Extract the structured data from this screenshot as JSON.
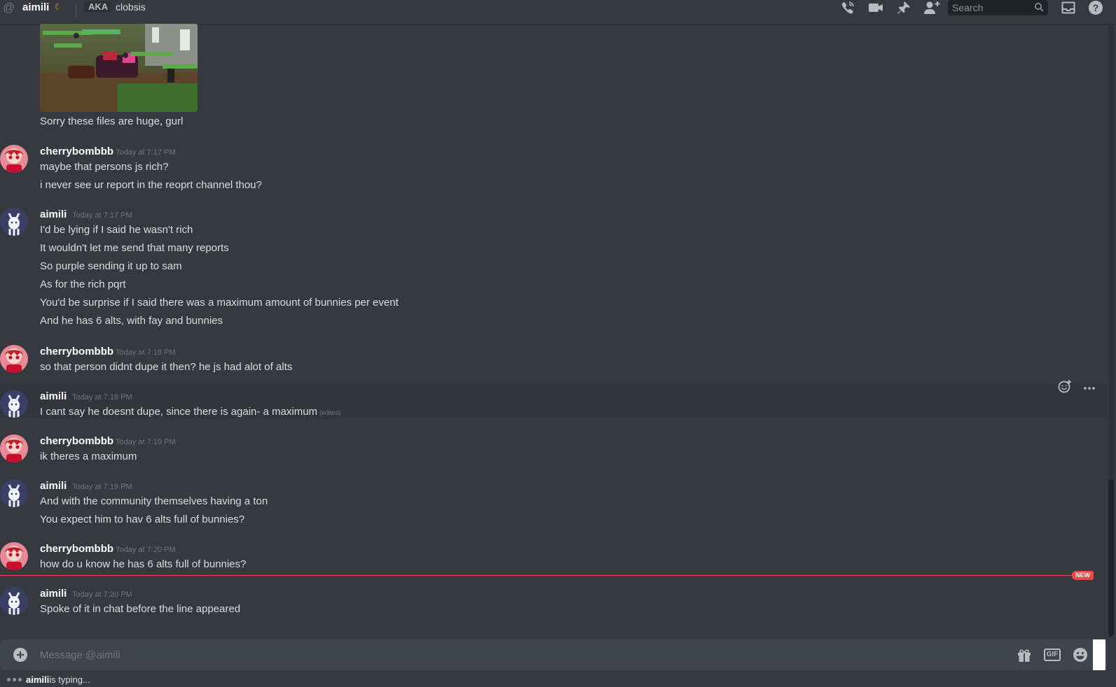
{
  "header": {
    "username": "aimili",
    "aka_label": "AKA",
    "nickname": "clobsis",
    "search_placeholder": "Search"
  },
  "attachment": {
    "caption": "Sorry these files are huge, gurl"
  },
  "messages": [
    {
      "author": "cherrybombbb",
      "timestamp": "Today at 7:17 PM",
      "lines": [
        "maybe that persons js rich?",
        "i never see ur report in the reoprt channel thou?"
      ]
    },
    {
      "author": "aimili",
      "timestamp": "Today at 7:17 PM",
      "lines": [
        "I'd be lying if I said he wasn't rich",
        "It wouldn't let me send that many reports",
        "So purple sending it up to sam",
        "As for the rich pqrt",
        "You'd be surprise if I said there was a maximum amount of bunnies per event",
        "And he has 6 alts, with fay and bunnies"
      ]
    },
    {
      "author": "cherrybombbb",
      "timestamp": "Today at 7:18 PM",
      "lines": [
        "so that person didnt dupe it then? he js had alot of alts"
      ]
    },
    {
      "author": "aimili",
      "timestamp": "Today at 7:18 PM",
      "lines": [
        "I cant say he doesnt dupe, since there is again- a maximum"
      ],
      "edited": "(edited)"
    },
    {
      "author": "cherrybombbb",
      "timestamp": "Today at 7:19 PM",
      "lines": [
        "ik theres a maximum"
      ]
    },
    {
      "author": "aimili",
      "timestamp": "Today at 7:19 PM",
      "lines": [
        "And with the community themselves having a ton",
        "You expect him to hav 6 alts full of bunnies?"
      ]
    },
    {
      "author": "cherrybombbb",
      "timestamp": "Today at 7:20 PM",
      "lines": [
        "how do u know he has 6 alts full of bunnies?"
      ]
    },
    {
      "author": "aimili",
      "timestamp": "Today at 7:20 PM",
      "lines": [
        "Spoke of it in chat before the line appeared"
      ]
    }
  ],
  "new_badge": "NEW",
  "composer": {
    "placeholder": "Message @aimili",
    "gif_label": "GIF"
  },
  "typing": {
    "user": "aimili",
    "text": " is typing..."
  },
  "colors": {
    "background": "#36393f",
    "new_divider": "#f04747",
    "composer": "#40444b",
    "status_idle": "#faa61a"
  }
}
